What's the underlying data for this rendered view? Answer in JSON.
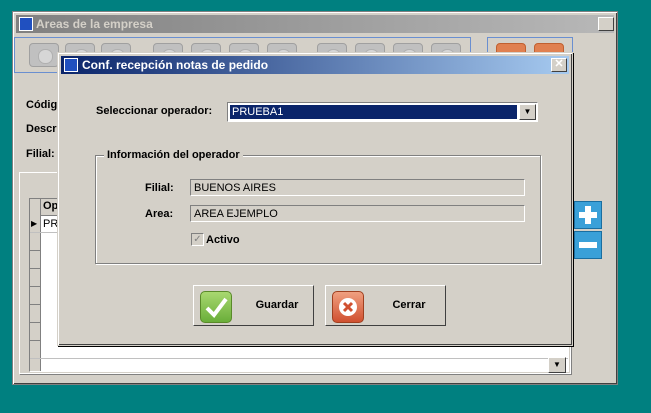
{
  "parent_window": {
    "title": "Areas de la empresa",
    "labels": {
      "codigo": "Códig",
      "descripcion": "Descr",
      "filial": "Filial:"
    },
    "grid": {
      "header_col": "Op",
      "first_row_value": "PR"
    }
  },
  "dialog": {
    "title": "Conf. recepción notas de pedido",
    "operator_label": "Seleccionar operador:",
    "operator_value": "PRUEBA1",
    "group_title": "Información del operador",
    "filial_label": "Filial:",
    "filial_value": "BUENOS AIRES",
    "area_label": "Area:",
    "area_value": "AREA EJEMPLO",
    "activo_label": "Activo",
    "activo_checked": true,
    "save_label": "Guardar",
    "close_label": "Cerrar"
  },
  "colors": {
    "desktop": "#008080",
    "dialog_title": "#0a246a",
    "selection": "#0a246a"
  }
}
